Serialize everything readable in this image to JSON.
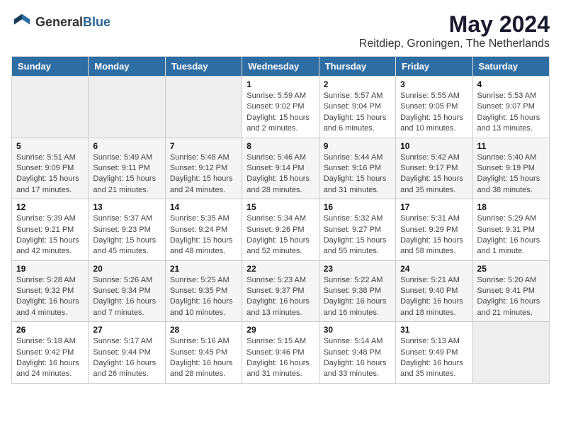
{
  "header": {
    "logo_general": "General",
    "logo_blue": "Blue",
    "main_title": "May 2024",
    "subtitle": "Reitdiep, Groningen, The Netherlands"
  },
  "weekdays": [
    "Sunday",
    "Monday",
    "Tuesday",
    "Wednesday",
    "Thursday",
    "Friday",
    "Saturday"
  ],
  "weeks": [
    [
      {
        "day": "",
        "info": ""
      },
      {
        "day": "",
        "info": ""
      },
      {
        "day": "",
        "info": ""
      },
      {
        "day": "1",
        "info": "Sunrise: 5:59 AM\nSunset: 9:02 PM\nDaylight: 15 hours and 2 minutes."
      },
      {
        "day": "2",
        "info": "Sunrise: 5:57 AM\nSunset: 9:04 PM\nDaylight: 15 hours and 6 minutes."
      },
      {
        "day": "3",
        "info": "Sunrise: 5:55 AM\nSunset: 9:05 PM\nDaylight: 15 hours and 10 minutes."
      },
      {
        "day": "4",
        "info": "Sunrise: 5:53 AM\nSunset: 9:07 PM\nDaylight: 15 hours and 13 minutes."
      }
    ],
    [
      {
        "day": "5",
        "info": "Sunrise: 5:51 AM\nSunset: 9:09 PM\nDaylight: 15 hours and 17 minutes."
      },
      {
        "day": "6",
        "info": "Sunrise: 5:49 AM\nSunset: 9:11 PM\nDaylight: 15 hours and 21 minutes."
      },
      {
        "day": "7",
        "info": "Sunrise: 5:48 AM\nSunset: 9:12 PM\nDaylight: 15 hours and 24 minutes."
      },
      {
        "day": "8",
        "info": "Sunrise: 5:46 AM\nSunset: 9:14 PM\nDaylight: 15 hours and 28 minutes."
      },
      {
        "day": "9",
        "info": "Sunrise: 5:44 AM\nSunset: 9:16 PM\nDaylight: 15 hours and 31 minutes."
      },
      {
        "day": "10",
        "info": "Sunrise: 5:42 AM\nSunset: 9:17 PM\nDaylight: 15 hours and 35 minutes."
      },
      {
        "day": "11",
        "info": "Sunrise: 5:40 AM\nSunset: 9:19 PM\nDaylight: 15 hours and 38 minutes."
      }
    ],
    [
      {
        "day": "12",
        "info": "Sunrise: 5:39 AM\nSunset: 9:21 PM\nDaylight: 15 hours and 42 minutes."
      },
      {
        "day": "13",
        "info": "Sunrise: 5:37 AM\nSunset: 9:23 PM\nDaylight: 15 hours and 45 minutes."
      },
      {
        "day": "14",
        "info": "Sunrise: 5:35 AM\nSunset: 9:24 PM\nDaylight: 15 hours and 48 minutes."
      },
      {
        "day": "15",
        "info": "Sunrise: 5:34 AM\nSunset: 9:26 PM\nDaylight: 15 hours and 52 minutes."
      },
      {
        "day": "16",
        "info": "Sunrise: 5:32 AM\nSunset: 9:27 PM\nDaylight: 15 hours and 55 minutes."
      },
      {
        "day": "17",
        "info": "Sunrise: 5:31 AM\nSunset: 9:29 PM\nDaylight: 15 hours and 58 minutes."
      },
      {
        "day": "18",
        "info": "Sunrise: 5:29 AM\nSunset: 9:31 PM\nDaylight: 16 hours and 1 minute."
      }
    ],
    [
      {
        "day": "19",
        "info": "Sunrise: 5:28 AM\nSunset: 9:32 PM\nDaylight: 16 hours and 4 minutes."
      },
      {
        "day": "20",
        "info": "Sunrise: 5:26 AM\nSunset: 9:34 PM\nDaylight: 16 hours and 7 minutes."
      },
      {
        "day": "21",
        "info": "Sunrise: 5:25 AM\nSunset: 9:35 PM\nDaylight: 16 hours and 10 minutes."
      },
      {
        "day": "22",
        "info": "Sunrise: 5:23 AM\nSunset: 9:37 PM\nDaylight: 16 hours and 13 minutes."
      },
      {
        "day": "23",
        "info": "Sunrise: 5:22 AM\nSunset: 9:38 PM\nDaylight: 16 hours and 16 minutes."
      },
      {
        "day": "24",
        "info": "Sunrise: 5:21 AM\nSunset: 9:40 PM\nDaylight: 16 hours and 18 minutes."
      },
      {
        "day": "25",
        "info": "Sunrise: 5:20 AM\nSunset: 9:41 PM\nDaylight: 16 hours and 21 minutes."
      }
    ],
    [
      {
        "day": "26",
        "info": "Sunrise: 5:18 AM\nSunset: 9:42 PM\nDaylight: 16 hours and 24 minutes."
      },
      {
        "day": "27",
        "info": "Sunrise: 5:17 AM\nSunset: 9:44 PM\nDaylight: 16 hours and 26 minutes."
      },
      {
        "day": "28",
        "info": "Sunrise: 5:16 AM\nSunset: 9:45 PM\nDaylight: 16 hours and 28 minutes."
      },
      {
        "day": "29",
        "info": "Sunrise: 5:15 AM\nSunset: 9:46 PM\nDaylight: 16 hours and 31 minutes."
      },
      {
        "day": "30",
        "info": "Sunrise: 5:14 AM\nSunset: 9:48 PM\nDaylight: 16 hours and 33 minutes."
      },
      {
        "day": "31",
        "info": "Sunrise: 5:13 AM\nSunset: 9:49 PM\nDaylight: 16 hours and 35 minutes."
      },
      {
        "day": "",
        "info": ""
      }
    ]
  ]
}
